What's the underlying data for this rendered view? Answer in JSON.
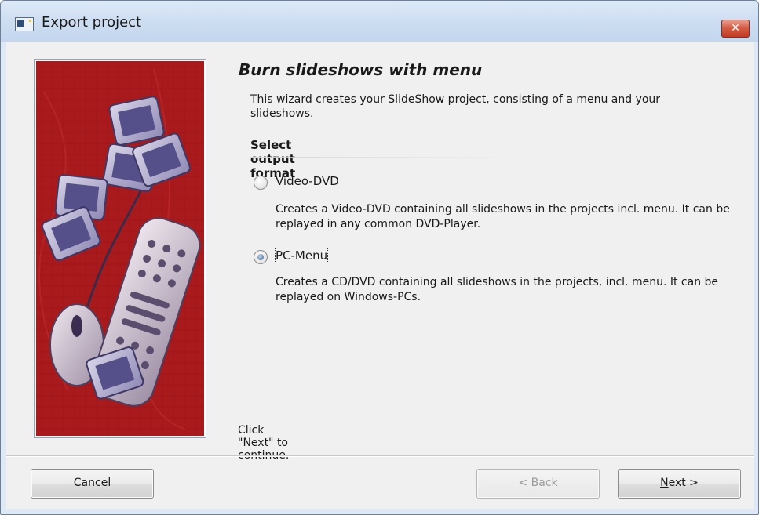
{
  "window": {
    "title": "Export project",
    "close_symbol": "x"
  },
  "wizard": {
    "heading": "Burn slideshows with menu",
    "description": "This wizard creates your SlideShow project, consisting of a menu and your slideshows.",
    "section_title": "Select output format",
    "options": [
      {
        "label": "Video-DVD",
        "checked": false,
        "description": "Creates a Video-DVD containing all slideshows in the projects incl. menu. It can be replayed in any common DVD-Player."
      },
      {
        "label": "PC-Menu",
        "checked": true,
        "description": "Creates a CD/DVD containing all slideshows in the projects, incl. menu. It can be replayed on Windows-PCs."
      }
    ],
    "hint": "Click \"Next\" to continue."
  },
  "buttons": {
    "cancel": "Cancel",
    "back": "< Back",
    "next_mnemonic": "N",
    "next_rest": "ext >"
  },
  "colors": {
    "image_background": "#a91a1d",
    "close_button": "#d35a42"
  },
  "icons": {
    "app": "export-project-icon",
    "close": "close-icon",
    "wizard_image": "slides-remote-mouse-illustration"
  }
}
